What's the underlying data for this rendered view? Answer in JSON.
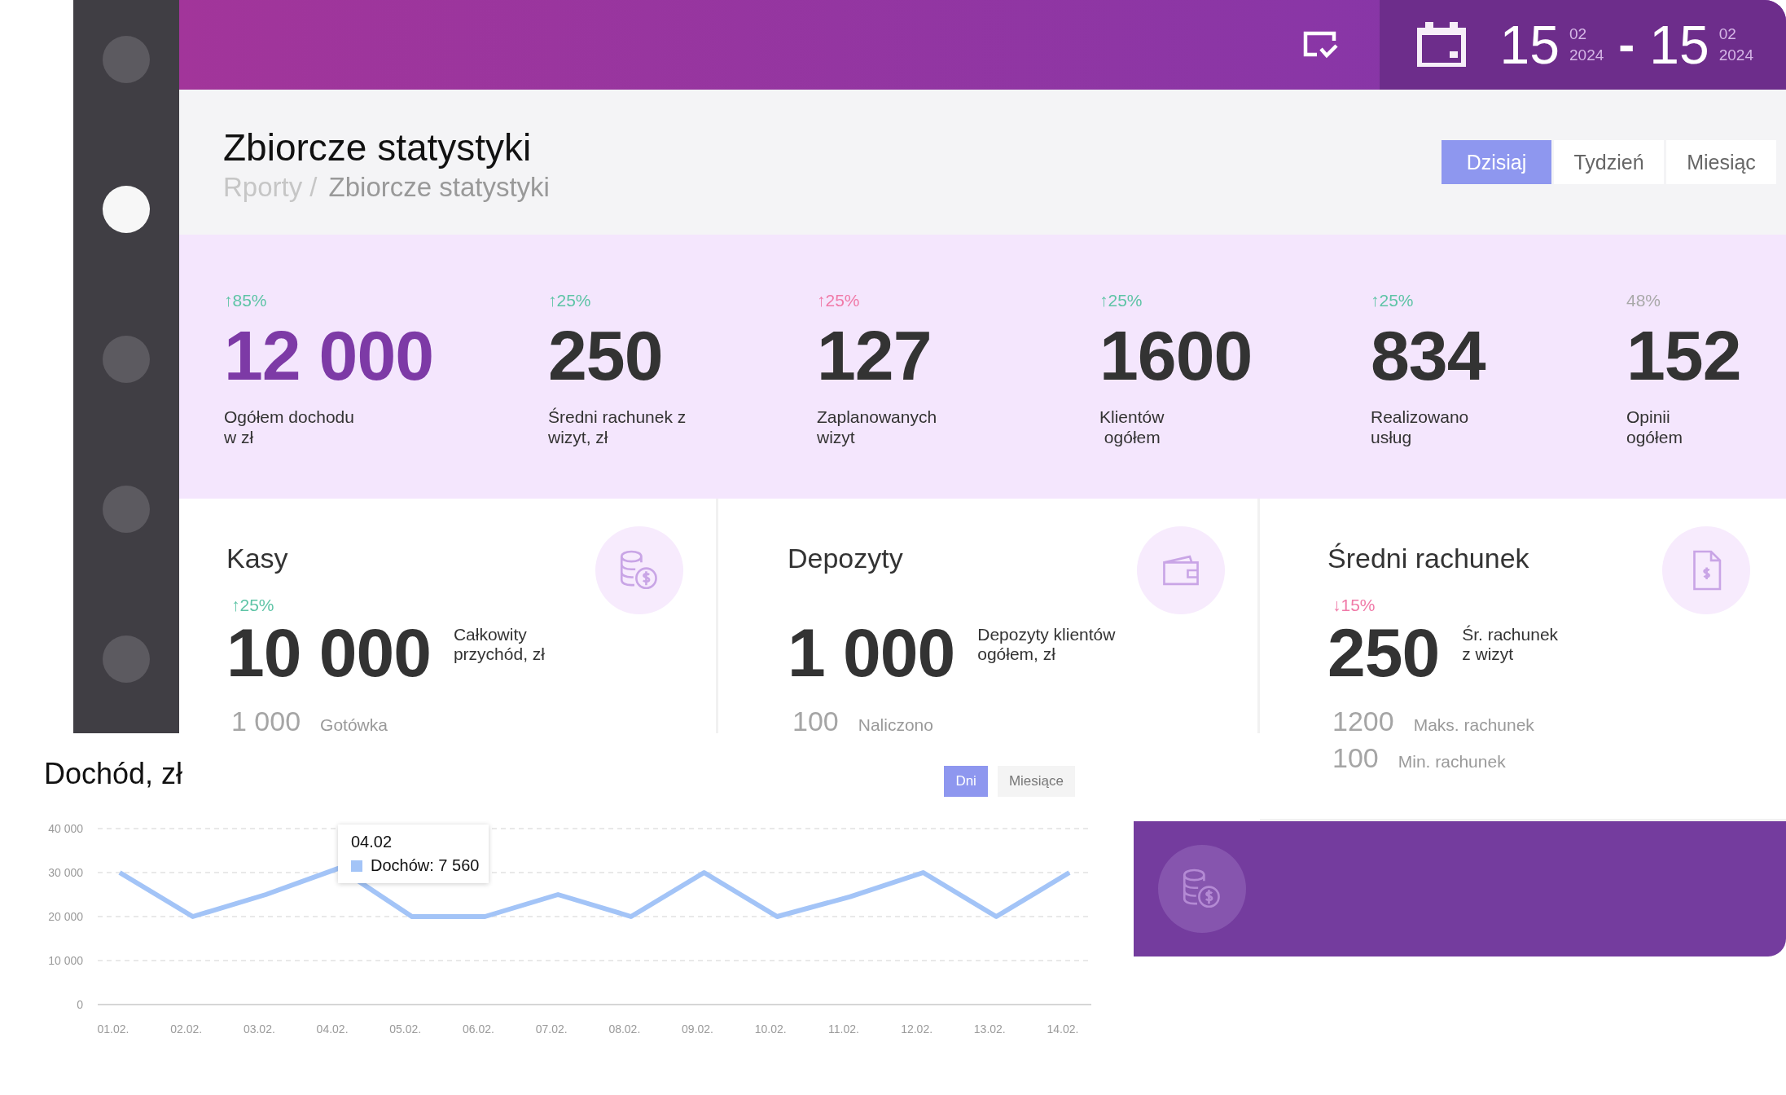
{
  "sidebar": {
    "items": [
      {
        "selected": false
      },
      {
        "selected": true
      },
      {
        "selected": false
      },
      {
        "selected": false
      },
      {
        "selected": false
      }
    ]
  },
  "top_bar": {
    "date_from": {
      "day": "15",
      "month": "02",
      "year": "2024"
    },
    "separator": "-",
    "date_to": {
      "day": "15",
      "month": "02",
      "year": "2024"
    }
  },
  "header": {
    "title": "Zbiorcze statystyki",
    "breadcrumbs": [
      {
        "label": "Rporty /",
        "current": false
      },
      {
        "label": "Zbiorcze statystyki",
        "current": true
      }
    ],
    "periods": [
      {
        "label": "Dzisiaj",
        "selected": true
      },
      {
        "label": "Tydzień",
        "selected": false
      },
      {
        "label": "Miesiąc",
        "selected": false
      }
    ]
  },
  "stats": [
    {
      "change": "↑85%",
      "color": "#5ec4a6",
      "value": "12 000",
      "highlight": true,
      "label": "Ogółem dochodu\nw zł"
    },
    {
      "change": "↑25%",
      "color": "#5ec4a6",
      "value": "250",
      "highlight": false,
      "label": "Średni rachunek z\nwizyt, zł"
    },
    {
      "change": "↑25%",
      "color": "#f07aa8",
      "value": "127",
      "highlight": false,
      "label": "Zaplanowanych\nwizyt"
    },
    {
      "change": "↑25%",
      "color": "#5ec4a6",
      "value": "1600",
      "highlight": false,
      "label": "Klientów\n ogółem"
    },
    {
      "change": "↑25%",
      "color": "#5ec4a6",
      "value": "834",
      "highlight": false,
      "label": "Realizowano\nusług"
    },
    {
      "change": "48%",
      "color": "#a9a9a9",
      "value": "152",
      "highlight": false,
      "label": "Opinii\nogółem"
    }
  ],
  "cards": [
    {
      "title": "Kasy",
      "change": "↑25%",
      "color": "#5ec4a6",
      "value": "10 000",
      "label": "Całkowity\nprzychód, zł",
      "details": [
        {
          "value": "1 000",
          "label": "Gotówka"
        }
      ]
    },
    {
      "title": "Depozyty",
      "value": "1 000",
      "label": "Depozyty klientów\nogółem, zł",
      "details": [
        {
          "value": "100",
          "label": "Naliczono"
        }
      ]
    },
    {
      "title": "Średni rachunek",
      "change": "↓15%",
      "color": "#f07aa8",
      "value": "250",
      "label": "Śr. rachunek\nz wizyt",
      "details": [
        {
          "value": "1200",
          "label": "Maks. rachunek"
        },
        {
          "value": "100",
          "label": "Min. rachunek"
        }
      ]
    }
  ],
  "income": {
    "title": "Dochód, zł",
    "ranges": [
      {
        "label": "Dni",
        "selected": true
      },
      {
        "label": "Miesiące",
        "selected": false
      }
    ],
    "tooltip": {
      "title": "04.02",
      "text": "Dochów: 7 560"
    },
    "chart_data": {
      "type": "line",
      "categories": [
        "01.02.",
        "02.02.",
        "03.02.",
        "04.02.",
        "05.02.",
        "06.02.",
        "07.02.",
        "08.02.",
        "09.02.",
        "10.02.",
        "11.02.",
        "12.02.",
        "13.02.",
        "14.02."
      ],
      "grid": true,
      "series": [
        {
          "color": "#a3c4f7",
          "values": [
            30000,
            20000,
            25000,
            31000,
            20000,
            20000,
            25000,
            20000,
            30000,
            20000,
            24500,
            30000,
            20000,
            30000
          ]
        }
      ],
      "ylim": [
        0,
        40000
      ],
      "yticks": [
        {
          "value": 0,
          "label": "0"
        },
        {
          "value": 10000,
          "label": "10 000"
        },
        {
          "value": 20000,
          "label": "20 000"
        },
        {
          "value": 30000,
          "label": "30 000"
        },
        {
          "value": 40000,
          "label": "40 000"
        }
      ]
    }
  }
}
